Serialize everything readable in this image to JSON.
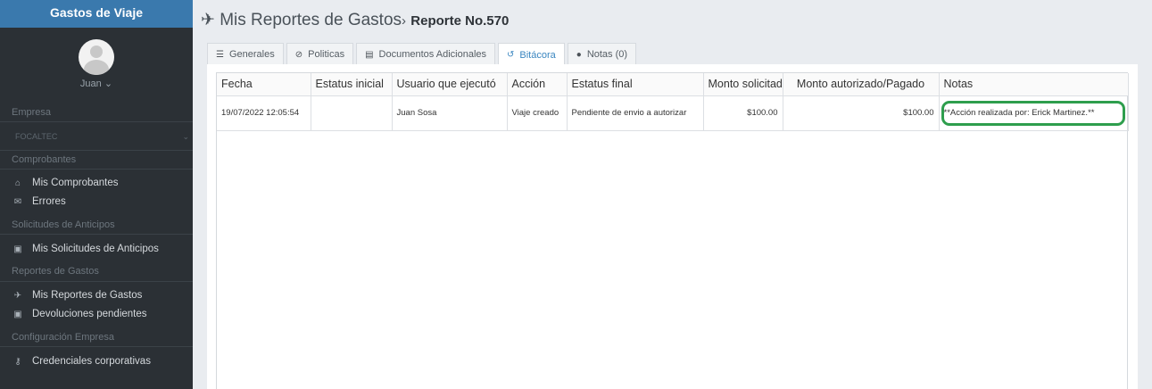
{
  "sidebar": {
    "brand": "Gastos de Viaje",
    "user": "Juan ⌄",
    "sections": {
      "empresa": "Empresa",
      "company_select": "FOCALTEC",
      "comprobantes": "Comprobantes",
      "solicitudes": "Solicitudes de Anticipos",
      "reportes": "Reportes de Gastos",
      "configuracion": "Configuración Empresa"
    },
    "items": {
      "mis_comprobantes": "Mis Comprobantes",
      "errores": "Errores",
      "mis_solicitudes": "Mis Solicitudes de Anticipos",
      "mis_reportes": "Mis Reportes de Gastos",
      "devoluciones": "Devoluciones pendientes",
      "credenciales": "Credenciales corporativas"
    }
  },
  "header": {
    "title": "Mis Reportes de Gastos",
    "separator": "›",
    "subtitle": "Reporte No.570"
  },
  "tabs": [
    {
      "label": "Generales",
      "icon": "list-icon"
    },
    {
      "label": "Politicas",
      "icon": "check-circle-icon"
    },
    {
      "label": "Documentos Adicionales",
      "icon": "file-icon"
    },
    {
      "label": "Bitácora",
      "icon": "history-icon",
      "active": true
    },
    {
      "label": "Notas (0)",
      "icon": "comments-icon"
    }
  ],
  "table": {
    "columns": [
      "Fecha",
      "Estatus inicial",
      "Usuario que ejecutó",
      "Acción",
      "Estatus final",
      "Monto solicitado",
      "Monto autorizado/Pagado",
      "Notas"
    ],
    "rows": [
      {
        "fecha": "19/07/2022 12:05:54",
        "estatus_inicial": "",
        "usuario": "Juan Sosa",
        "accion": "Viaje creado",
        "estatus_final": "Pendiente de envio a autorizar",
        "monto_solicitado": "$100.00",
        "monto_autorizado": "$100.00",
        "notas": "**Acción realizada por: Erick Martinez.**"
      }
    ]
  },
  "colors": {
    "sidebar_bg": "#2b3035",
    "brand_bg": "#3a79ad",
    "active_tab": "#3a86c0",
    "highlight": "#2e9e4d"
  }
}
